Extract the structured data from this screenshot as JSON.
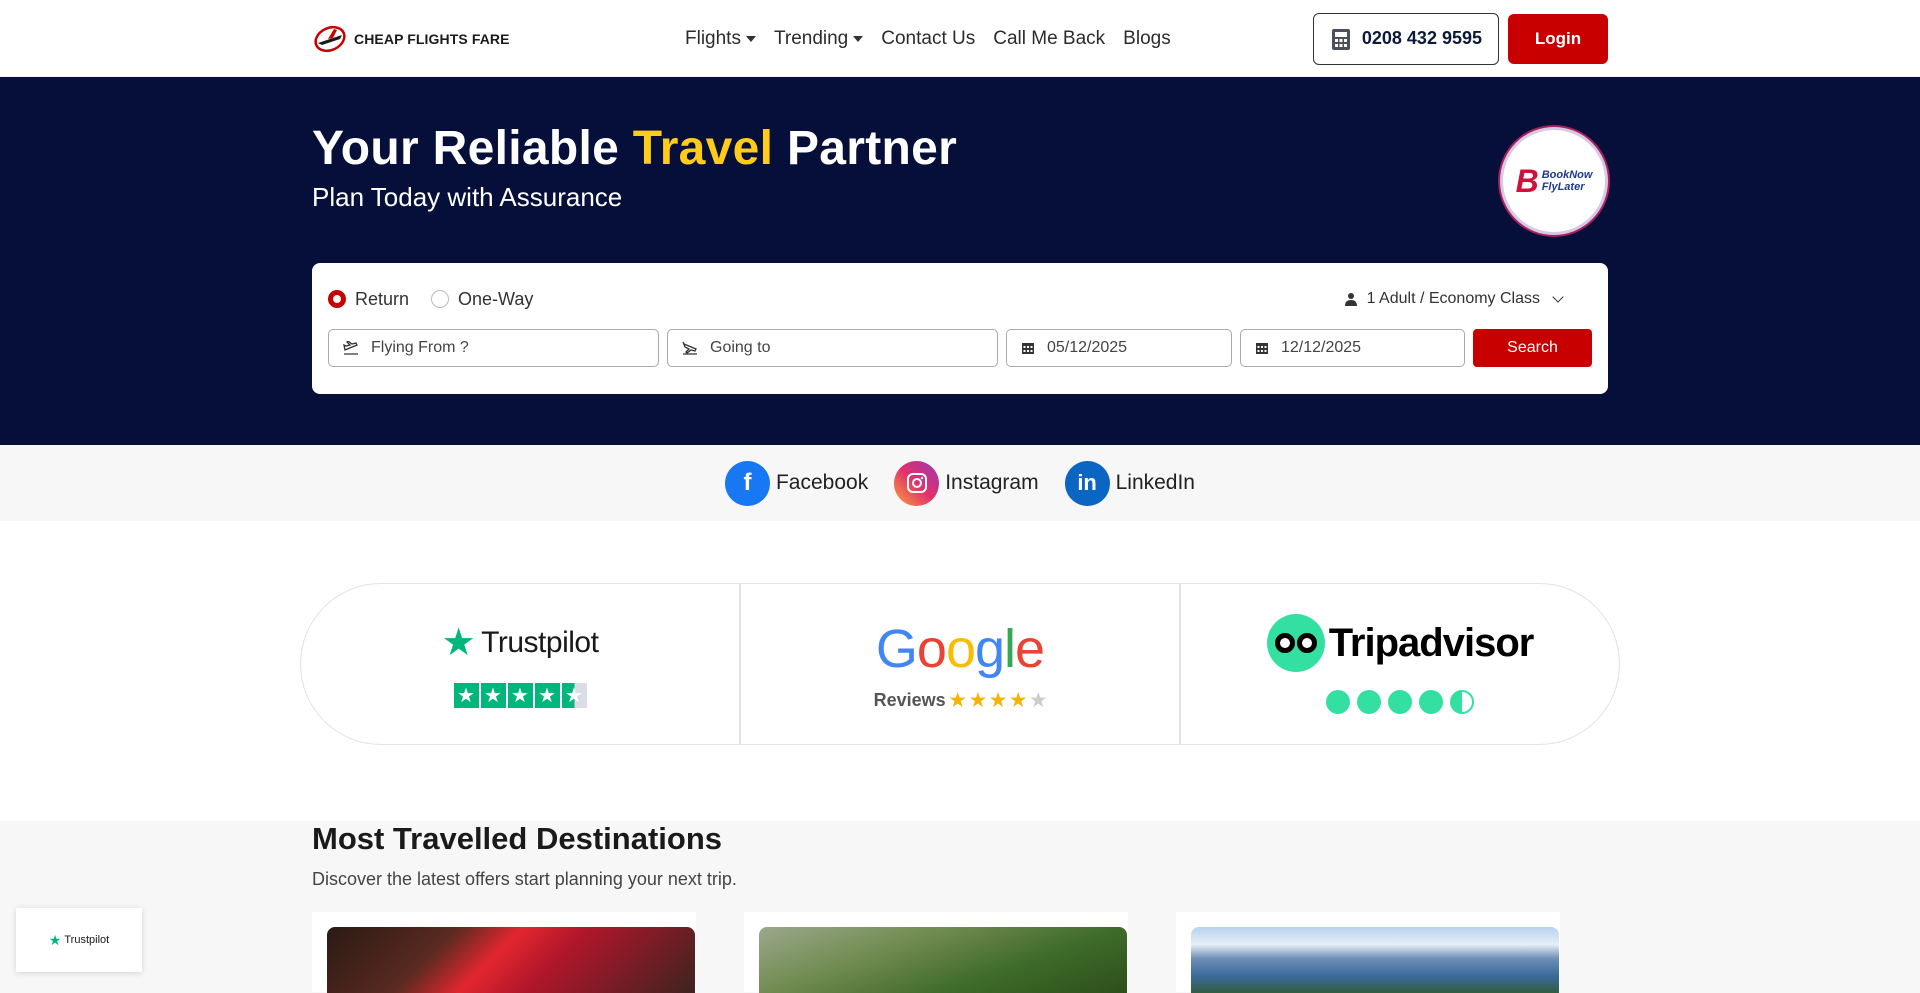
{
  "nav": {
    "logo_text": "CHEAP FLIGHTS FARE",
    "links": [
      "Flights",
      "Trending",
      "Contact Us",
      "Call Me Back",
      "Blogs"
    ],
    "phone": "0208 432 9595",
    "login": "Login"
  },
  "hero": {
    "title_pre": "Your Reliable ",
    "title_hl": "Travel",
    "title_post": " Partner",
    "subtitle": "Plan Today with Assurance",
    "badge_line1": "BookNow",
    "badge_line2": "FlyLater"
  },
  "search": {
    "trip_return": "Return",
    "trip_oneway": "One-Way",
    "selected_trip": "Return",
    "passengers": "1 Adult / Economy Class",
    "from_placeholder": "Flying From ?",
    "to_placeholder": "Going to",
    "depart_date": "05/12/2025",
    "return_date": "12/12/2025",
    "button": "Search"
  },
  "social": [
    "Facebook",
    "Instagram",
    "LinkedIn"
  ],
  "reviews": {
    "trustpilot": "Trustpilot",
    "trustpilot_rating": 4.5,
    "google": "Google",
    "google_reviews": "Reviews",
    "google_rating": 4,
    "tripadvisor": "Tripadvisor",
    "tripadvisor_rating": 4.5
  },
  "destinations": {
    "title": "Most Travelled Destinations",
    "subtitle": "Discover the latest offers start planning your next trip."
  },
  "badge": {
    "label": "Trustpilot"
  },
  "colors": {
    "brand_red": "#c80000",
    "hero_bg": "#050f3a",
    "highlight": "#ffcd19"
  }
}
